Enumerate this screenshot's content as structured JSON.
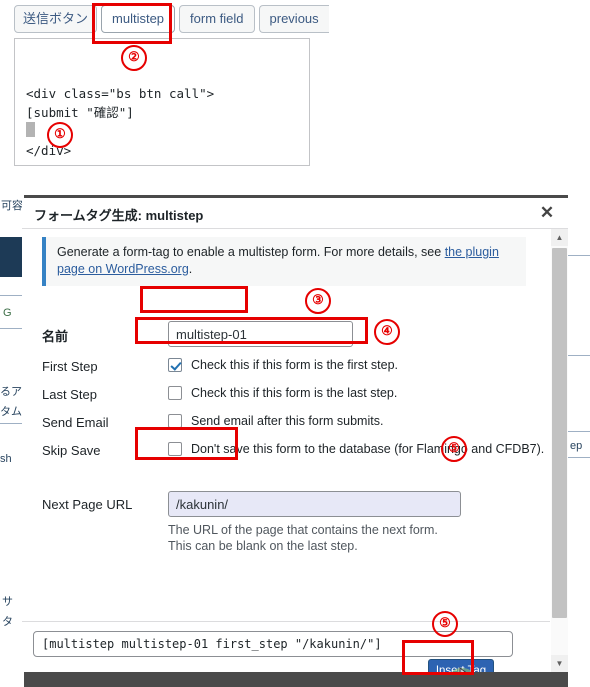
{
  "top_panel": {
    "tabs": [
      {
        "label": "送信ボタン",
        "active": false,
        "jp": true
      },
      {
        "label": "multistep",
        "active": true,
        "jp": false
      },
      {
        "label": "form field",
        "active": false,
        "jp": false
      },
      {
        "label": "previous",
        "active": false,
        "jp": false
      }
    ],
    "code_content": "<div class=\"bs btn call\">\n[submit \"確認\"]\n\n</div>"
  },
  "background_page": {
    "left_fragments": [
      "可容",
      "G",
      "るア",
      "タム",
      "sh",
      "サ",
      "タ"
    ],
    "right_fragments": [
      "ep"
    ]
  },
  "modal": {
    "title_main": "フォームタグ生成",
    "title_sep": ": ",
    "title_sub": "multistep",
    "close_label": "✕",
    "info": {
      "text_before": "Generate a form-tag to enable a multistep form. For more details, see ",
      "link_text": "the plugin page on WordPress.org",
      "text_after": "."
    },
    "fields": {
      "name": {
        "label": "名前",
        "value": "multistep-01"
      },
      "first_step": {
        "label": "First Step",
        "checkbox_text": "Check this if this form is the first step.",
        "checked": true
      },
      "last_step": {
        "label": "Last Step",
        "checkbox_text": "Check this if this form is the last step.",
        "checked": false
      },
      "send_email": {
        "label": "Send Email",
        "checkbox_text": "Send email after this form submits.",
        "checked": false
      },
      "skip_save": {
        "label": "Skip Save",
        "checkbox_text": "Don't save this form to the database (for Flamingo and CFDB7).",
        "checked": false
      },
      "next_page_url": {
        "label": "Next Page URL",
        "value": "/kakunin/",
        "help": "The URL of the page that contains the next form.\nThis can be blank on the last step."
      }
    },
    "footer": {
      "tag_output": "[multistep multistep-01 first_step \"/kakunin/\"]",
      "insert_button": "Insert Tag"
    },
    "scrollbar": {
      "up_arrow": "▲",
      "down_arrow": "▼"
    }
  },
  "annotations": {
    "marker_1": "①",
    "marker_2": "②",
    "marker_3": "③",
    "marker_4": "④",
    "marker_5": "⑤",
    "marker_5b": "⑤",
    "color": "#e60000"
  }
}
